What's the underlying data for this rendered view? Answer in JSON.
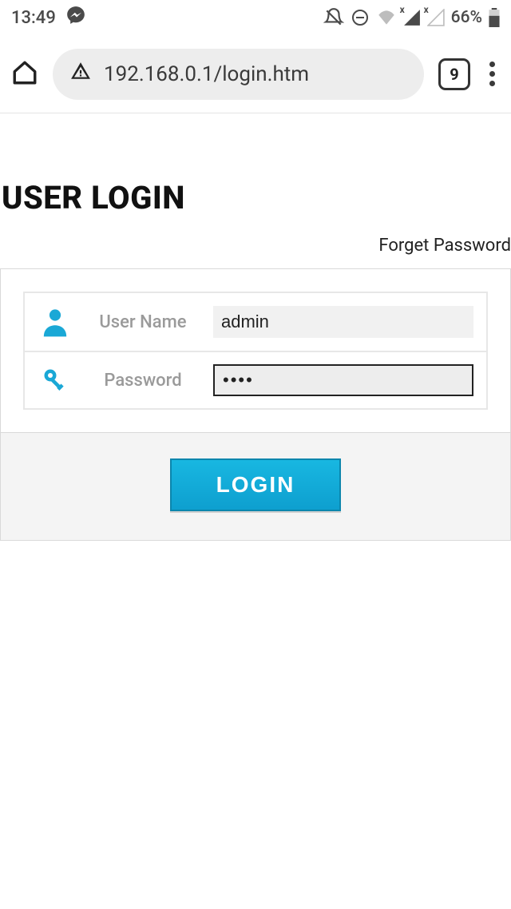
{
  "status_bar": {
    "time": "13:49",
    "battery_percent": "66%"
  },
  "browser": {
    "url": "192.168.0.1/login.htm",
    "tab_count": "9"
  },
  "login": {
    "title": "USER LOGIN",
    "forgot_label": "Forget Password",
    "username_label": "User Name",
    "username_value": "admin",
    "password_label": "Password",
    "password_value": "••••",
    "login_button": "LOGIN"
  }
}
